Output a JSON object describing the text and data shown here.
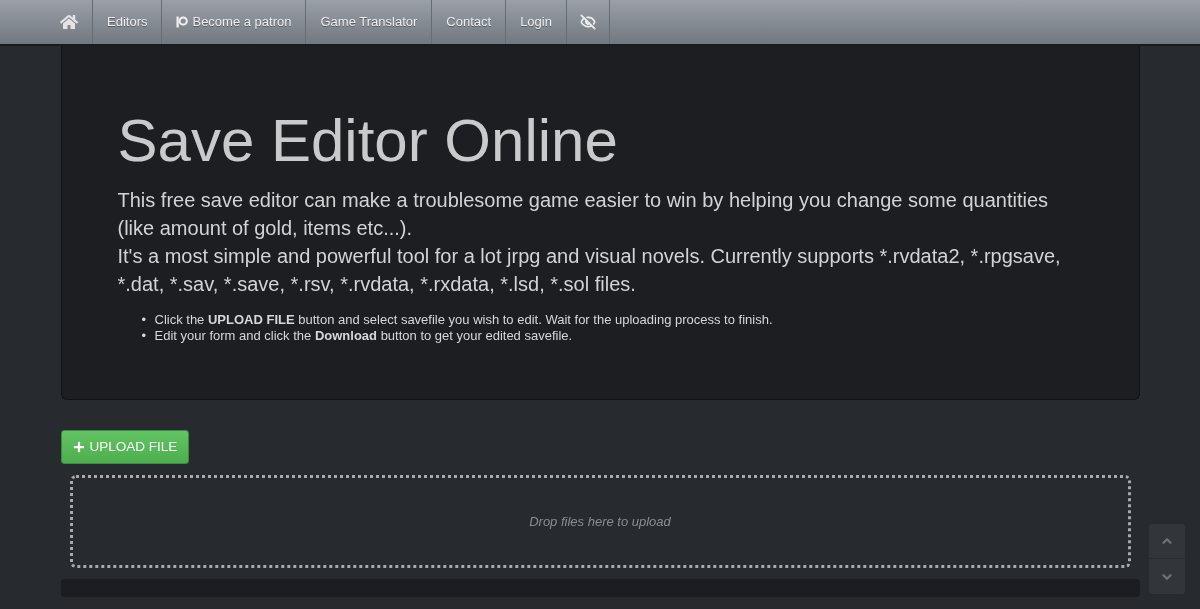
{
  "nav": {
    "links": [
      {
        "kind": "text_link",
        "label": "Editors"
      },
      {
        "kind": "logo_link",
        "label": "Become a patron"
      },
      {
        "kind": "text_link",
        "label": "Game Translator"
      },
      {
        "kind": "text_link",
        "label": "Contact"
      },
      {
        "kind": "text_link",
        "label": "Login"
      }
    ]
  },
  "hero": {
    "title": "Save Editor Online",
    "paragraphs": [
      "This free save editor can make a troublesome game easier to win by helping you change some quantities (like amount of gold, items etc...).",
      "It's a most simple and powerful tool for a lot jrpg and visual novels. Currently supports *.rvdata2, *.rpgsave, *.dat, *.sav, *.save, *.rsv, *.rvdata, *.rxdata, *.lsd, *.sol files."
    ],
    "steps": [
      {
        "marker": "•",
        "text": "Click the **UPLOAD FILE** button and select savefile you wish to edit. Wait for the uploading process to finish."
      },
      {
        "marker": "•",
        "text": "Edit your form and click the **Download** button to get your edited savefile."
      }
    ]
  },
  "upload_button": {
    "label": "UPLOAD FILE"
  },
  "dropzone": {
    "message": "Drop files here to upload"
  }
}
